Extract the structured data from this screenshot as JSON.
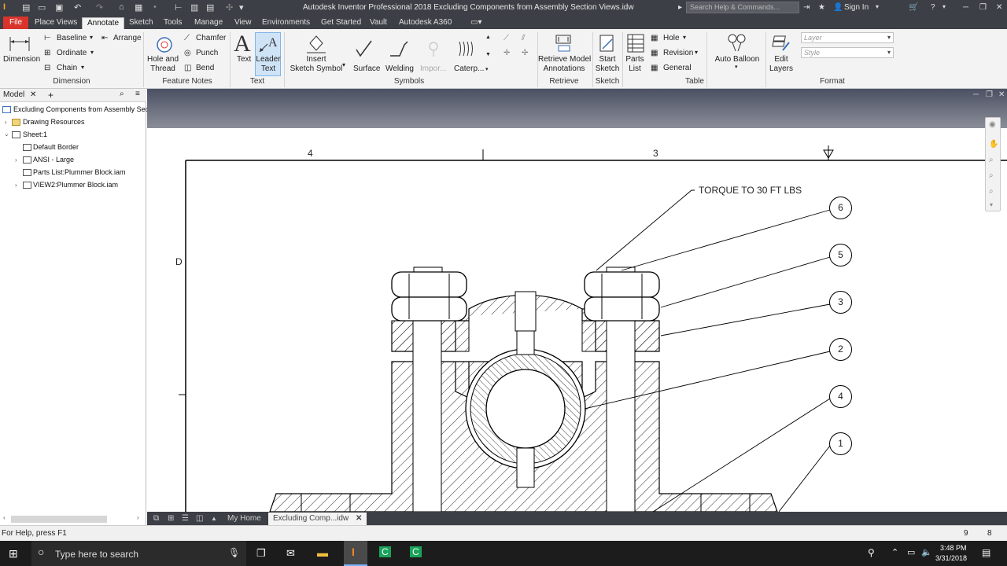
{
  "app": {
    "title": "Autodesk Inventor Professional 2018    Excluding Components from Assembly Section Views.idw",
    "search_placeholder": "Search Help & Commands...",
    "sign_in": "Sign In"
  },
  "tabs": [
    "File",
    "Place Views",
    "Annotate",
    "Sketch",
    "Tools",
    "Manage",
    "View",
    "Environments",
    "Get Started",
    "Vault",
    "Autodesk A360"
  ],
  "ribbon": {
    "dimension": {
      "big": "Dimension",
      "baseline": "Baseline",
      "arrange": "Arrange",
      "ordinate": "Ordinate",
      "chain": "Chain",
      "group": "Dimension"
    },
    "feature_notes": {
      "hole_thread": [
        "Hole and",
        "Thread"
      ],
      "chamfer": "Chamfer",
      "punch": "Punch",
      "bend": "Bend",
      "group": "Feature Notes"
    },
    "text": {
      "text": "Text",
      "leader_text": [
        "Leader",
        "Text"
      ],
      "group": "Text"
    },
    "symbols": {
      "insert_sketch_symbol": [
        "Insert",
        "Sketch Symbol"
      ],
      "surface": "Surface",
      "welding": "Welding",
      "import": "Impor...",
      "caterpillar": "Caterp...",
      "group": "Symbols"
    },
    "retrieve": {
      "retrieve_model": [
        "Retrieve Model",
        "Annotations"
      ],
      "group": "Retrieve"
    },
    "sketch": {
      "start_sketch": [
        "Start",
        "Sketch"
      ],
      "group": "Sketch"
    },
    "table": {
      "parts_list": [
        "Parts",
        "List"
      ],
      "hole": "Hole",
      "revision": "Revision",
      "general": "General",
      "group": "Table"
    },
    "auto_balloon": "Auto Balloon",
    "edit_layers": [
      "Edit",
      "Layers"
    ],
    "format": {
      "layer": "Layer",
      "style": "Style",
      "group": "Format"
    }
  },
  "browser": {
    "tab": "Model",
    "root": "Excluding Components from Assembly Secti",
    "items": [
      "Drawing Resources",
      "Sheet:1",
      "Default Border",
      "ANSI - Large",
      "Parts List:Plummer Block.iam",
      "VIEW2:Plummer Block.iam"
    ]
  },
  "drawing": {
    "zone_cols": [
      "4",
      "3"
    ],
    "zone_row": "D",
    "note": "TORQUE TO 30 FT LBS",
    "balloons": [
      "6",
      "5",
      "3",
      "2",
      "4",
      "1"
    ]
  },
  "doc_tabs": {
    "home": "My Home",
    "active": "Excluding Comp...idw"
  },
  "status": {
    "help": "For Help, press F1",
    "a": "9",
    "b": "8"
  },
  "taskbar": {
    "search": "Type here to search",
    "time": "3:48 PM",
    "date": "3/31/2018"
  }
}
